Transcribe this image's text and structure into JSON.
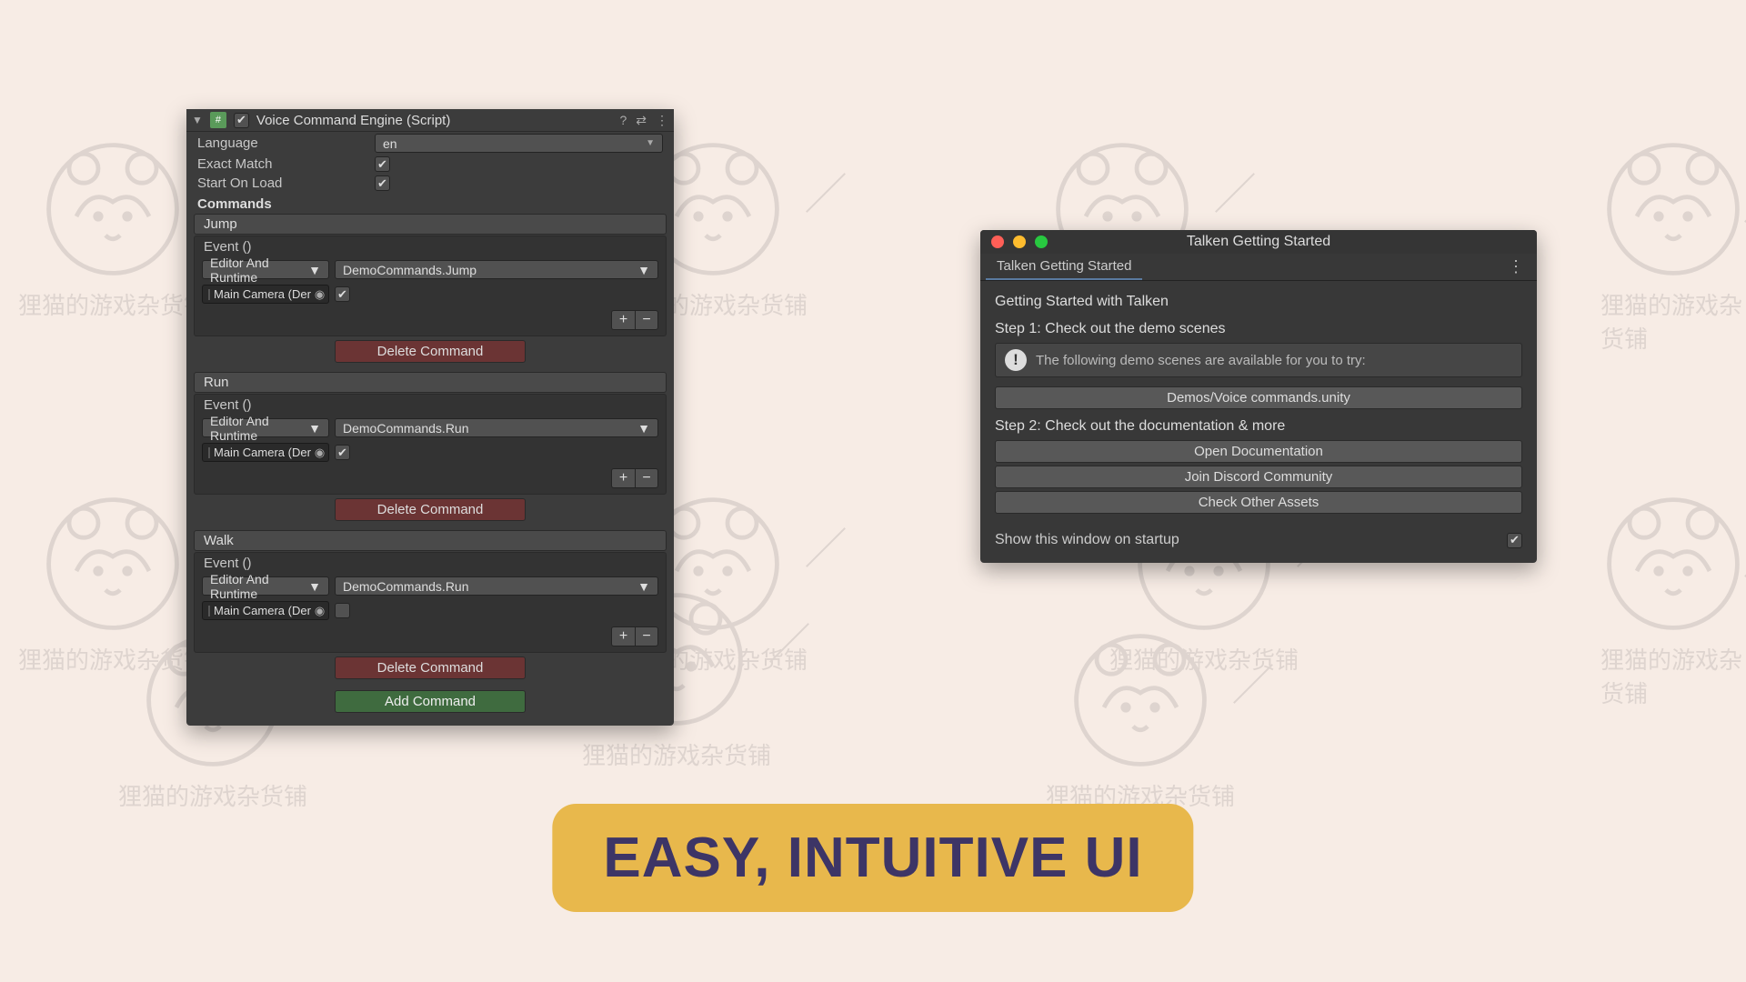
{
  "watermark_text": "狸猫的游戏杂货铺",
  "inspector": {
    "title": "Voice Command Engine (Script)",
    "fields": {
      "language": {
        "label": "Language",
        "value": "en"
      },
      "exactMatch": {
        "label": "Exact Match",
        "checked": true
      },
      "startOnLoad": {
        "label": "Start On Load",
        "checked": true
      }
    },
    "commandsLabel": "Commands",
    "eventLabel": "Event ()",
    "editorRuntime": "Editor And Runtime",
    "cameraObj": "Main Camera (Der",
    "commands": [
      {
        "name": "Jump",
        "function": "DemoCommands.Jump",
        "argChecked": true
      },
      {
        "name": "Run",
        "function": "DemoCommands.Run",
        "argChecked": true
      },
      {
        "name": "Walk",
        "function": "DemoCommands.Run",
        "argChecked": false
      }
    ],
    "deleteLabel": "Delete Command",
    "addLabel": "Add Command",
    "plus": "+",
    "minus": "−"
  },
  "gettingStarted": {
    "windowTitle": "Talken Getting Started",
    "tab": "Talken Getting Started",
    "heading": "Getting Started with Talken",
    "step1Label": "Step 1: Check out the demo scenes",
    "infoText": "The following demo scenes are available for you to try:",
    "demoButton": "Demos/Voice commands.unity",
    "step2Label": "Step 2: Check out the documentation & more",
    "buttons": {
      "doc": "Open Documentation",
      "discord": "Join Discord Community",
      "assets": "Check Other Assets"
    },
    "showOnStartup": "Show this window on startup"
  },
  "banner": "EASY, INTUITIVE UI"
}
